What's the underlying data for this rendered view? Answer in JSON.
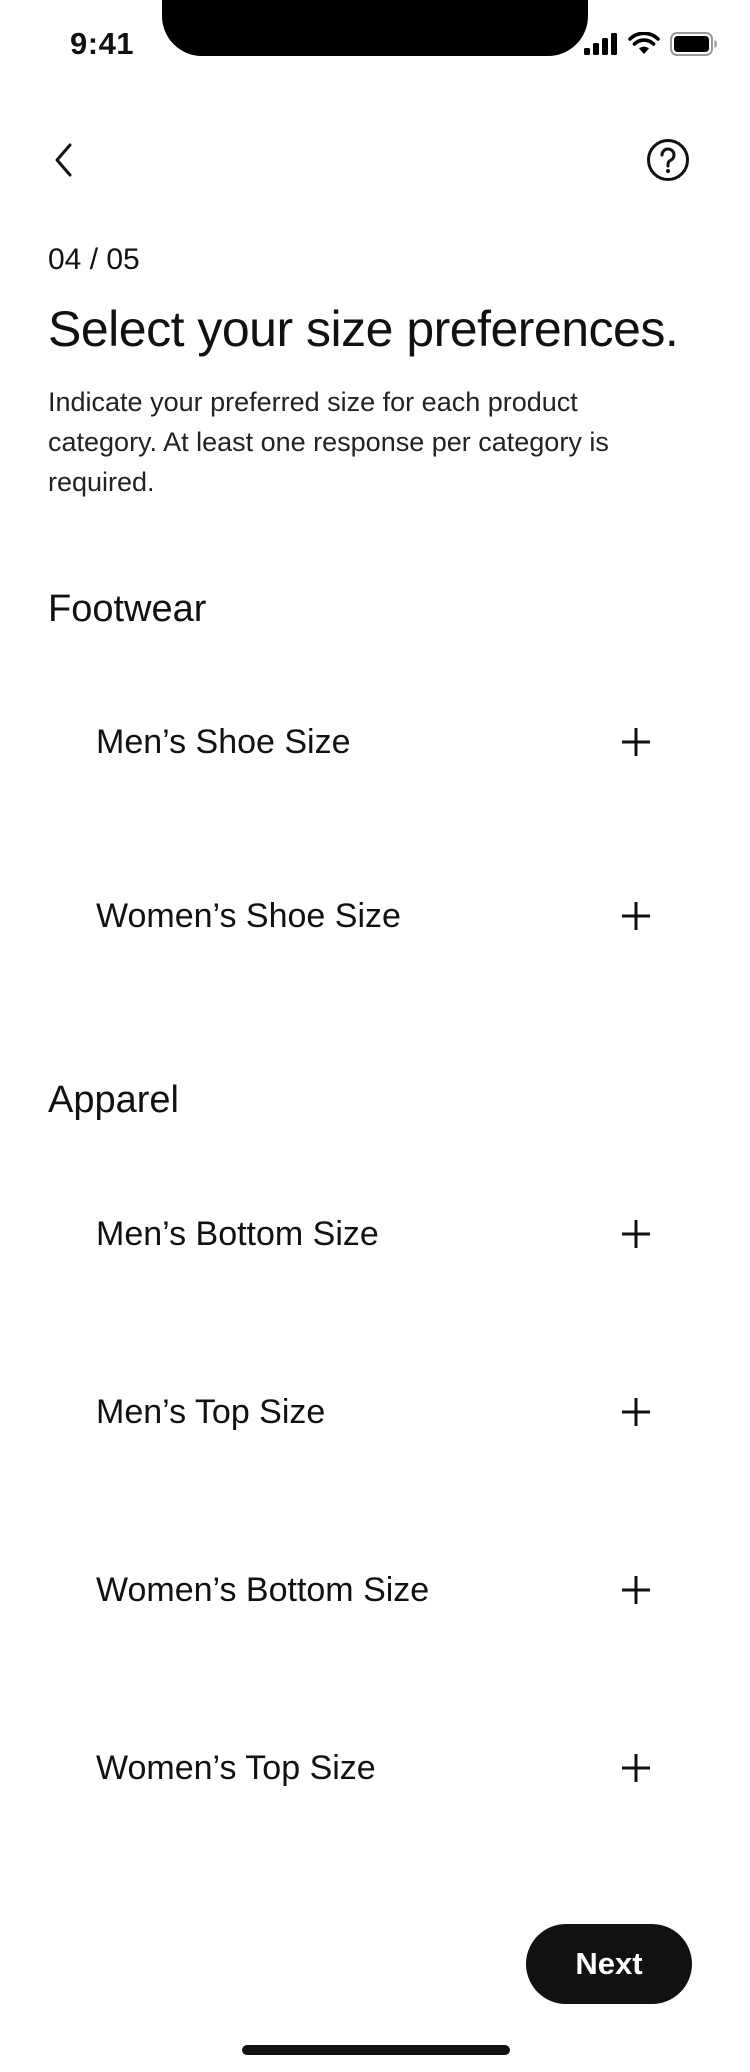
{
  "status_bar": {
    "time": "9:41",
    "icons": [
      "cellular-signal-icon",
      "wifi-icon",
      "battery-icon"
    ]
  },
  "nav": {
    "back_icon": "chevron-left-icon",
    "help_icon": "question-circle-icon"
  },
  "step": {
    "counter": "04 / 05"
  },
  "header": {
    "title": "Select your size preferences.",
    "description": "Indicate your preferred size for each product category. At least one response per category is required."
  },
  "sections": [
    {
      "heading": "Footwear",
      "options": [
        {
          "label": "Men’s Shoe Size",
          "icon": "plus-icon"
        },
        {
          "label": "Women’s Shoe Size",
          "icon": "plus-icon"
        }
      ]
    },
    {
      "heading": "Apparel",
      "options": [
        {
          "label": "Men’s Bottom Size",
          "icon": "plus-icon"
        },
        {
          "label": "Men’s Top Size",
          "icon": "plus-icon"
        },
        {
          "label": "Women’s Bottom Size",
          "icon": "plus-icon"
        },
        {
          "label": "Women’s Top Size",
          "icon": "plus-icon"
        }
      ]
    }
  ],
  "footer": {
    "next_label": "Next"
  },
  "colors": {
    "text": "#111111",
    "background": "#ffffff",
    "button_bg": "#111111",
    "button_text": "#ffffff"
  }
}
